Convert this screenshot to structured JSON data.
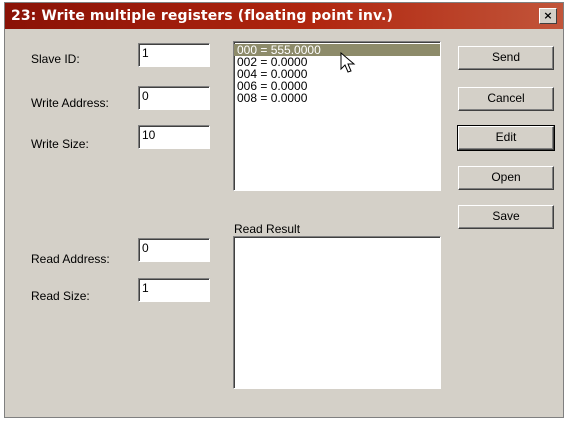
{
  "window": {
    "title": "23: Write multiple registers (floating point inv.)",
    "close_glyph": "×"
  },
  "form": {
    "slave_id_label": "Slave ID:",
    "slave_id_value": "1",
    "write_address_label": "Write Address:",
    "write_address_value": "0",
    "write_size_label": "Write Size:",
    "write_size_value": "10",
    "read_address_label": "Read Address:",
    "read_address_value": "0",
    "read_size_label": "Read Size:",
    "read_size_value": "1"
  },
  "write_list": {
    "items": [
      "000 = 555.0000",
      "002 = 0.0000",
      "004 = 0.0000",
      "006 = 0.0000",
      "008 = 0.0000"
    ],
    "selected_index": 0
  },
  "read_result": {
    "label": "Read Result"
  },
  "buttons": {
    "send": "Send",
    "cancel": "Cancel",
    "edit": "Edit",
    "open": "Open",
    "save": "Save"
  },
  "colors": {
    "title_bar": "#8a1206",
    "dialog_bg": "#d4d0c8",
    "selected_item": "#8d8b6a"
  }
}
